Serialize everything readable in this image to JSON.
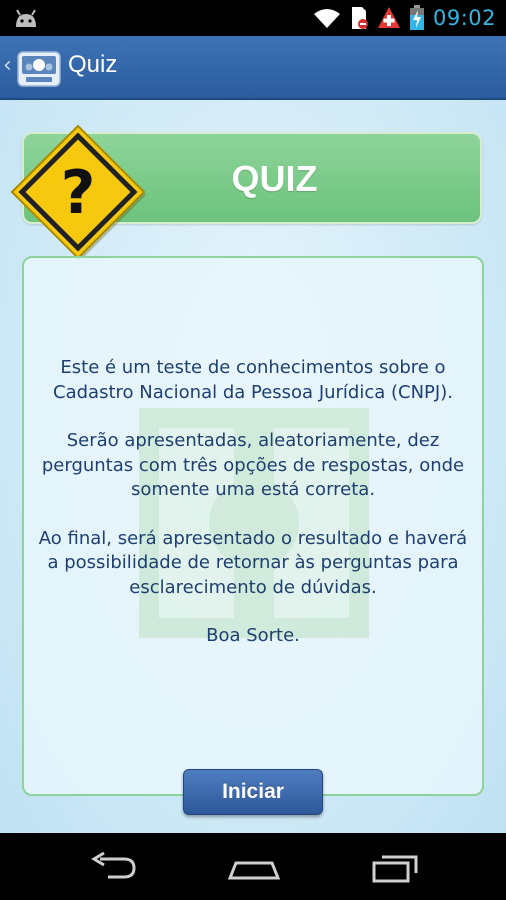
{
  "status_bar": {
    "time": "09:02",
    "icons": [
      "android-debug-icon",
      "wifi-icon",
      "sim-icon",
      "medical-cross-icon",
      "battery-charging-icon"
    ]
  },
  "action_bar": {
    "title": "Quiz",
    "logo_icon": "receita-federal-logo-icon",
    "back_icon": "chevron-left-icon"
  },
  "header": {
    "title": "QUIZ",
    "sign_icon": "question-warning-sign-icon",
    "sign_text": "?"
  },
  "info": {
    "paragraph_1": "Este é um teste de conhecimentos sobre o Cadastro Nacional da Pessoa Jurídica (CNPJ).",
    "paragraph_2": "Serão apresentadas, aleatoriamente, dez perguntas com três opções de respostas, onde somente uma está correta.",
    "paragraph_3": "Ao final, será apresentado o resultado e haverá a possibilidade de retornar às perguntas para esclarecimento de dúvidas.",
    "paragraph_4": "Boa Sorte."
  },
  "start_button": {
    "label": "Iniciar"
  },
  "nav_bar": {
    "icons": [
      "back-icon",
      "home-icon",
      "recent-apps-icon"
    ]
  },
  "colors": {
    "action_bar": "#3d73b5",
    "header_green": "#6cc37c",
    "clock_blue": "#33b5e5",
    "text_blue": "#1e3f70",
    "sign_yellow": "#f7c90e"
  }
}
